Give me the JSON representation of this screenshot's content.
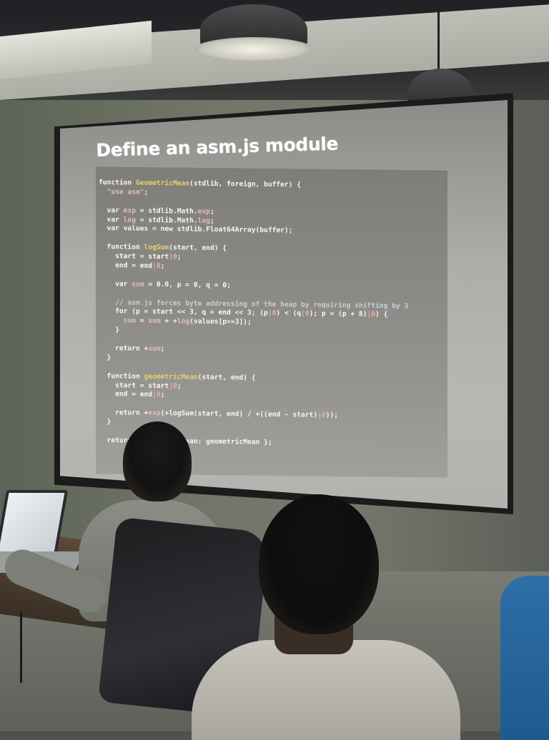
{
  "slide": {
    "title": "Define an asm.js module",
    "code": [
      {
        "parts": [
          [
            "kw",
            "function "
          ],
          [
            "fn",
            "GeometricMean"
          ],
          [
            "kw",
            "(stdlib, foreign, buffer) {"
          ]
        ]
      },
      {
        "parts": [
          [
            "str",
            "  \"use asm\""
          ],
          [
            "kw",
            ";"
          ]
        ]
      },
      {
        "parts": [
          [
            "kw",
            ""
          ]
        ]
      },
      {
        "parts": [
          [
            "kw",
            "  var "
          ],
          [
            "str",
            "exp"
          ],
          [
            "kw",
            " = stdlib.Math."
          ],
          [
            "str",
            "exp"
          ],
          [
            "kw",
            ";"
          ]
        ]
      },
      {
        "parts": [
          [
            "kw",
            "  var "
          ],
          [
            "str",
            "log"
          ],
          [
            "kw",
            " = stdlib.Math."
          ],
          [
            "str",
            "log"
          ],
          [
            "kw",
            ";"
          ]
        ]
      },
      {
        "parts": [
          [
            "kw",
            "  var values = new stdlib.Float64Array(buffer);"
          ]
        ]
      },
      {
        "parts": [
          [
            "kw",
            ""
          ]
        ]
      },
      {
        "parts": [
          [
            "kw",
            "  function "
          ],
          [
            "fn",
            "logSum"
          ],
          [
            "kw",
            "(start, end) {"
          ]
        ]
      },
      {
        "parts": [
          [
            "kw",
            "    start = start"
          ],
          [
            "bar",
            "|0"
          ],
          [
            "kw",
            ";"
          ]
        ]
      },
      {
        "parts": [
          [
            "kw",
            "    end = end"
          ],
          [
            "bar",
            "|0"
          ],
          [
            "kw",
            ";"
          ]
        ]
      },
      {
        "parts": [
          [
            "kw",
            ""
          ]
        ]
      },
      {
        "parts": [
          [
            "kw",
            "    var "
          ],
          [
            "str",
            "sum"
          ],
          [
            "kw",
            " = 0.0, p = 0, q = 0;"
          ]
        ]
      },
      {
        "parts": [
          [
            "kw",
            ""
          ]
        ]
      },
      {
        "parts": [
          [
            "cm",
            "    // asm.js forces byte addressing of the heap by requiring shifting by 3"
          ]
        ]
      },
      {
        "parts": [
          [
            "kw",
            "    for (p = start << 3, q = end << 3; (p"
          ],
          [
            "bar",
            "|0"
          ],
          [
            "kw",
            ") < (q"
          ],
          [
            "bar",
            "|0"
          ],
          [
            "kw",
            "); p = (p + 8)"
          ],
          [
            "bar",
            "|0"
          ],
          [
            "kw",
            ") {"
          ]
        ]
      },
      {
        "parts": [
          [
            "kw",
            "      "
          ],
          [
            "str",
            "sum"
          ],
          [
            "kw",
            " = "
          ],
          [
            "str",
            "sum"
          ],
          [
            "kw",
            " + +"
          ],
          [
            "str",
            "log"
          ],
          [
            "kw",
            "(values[p>>3]);"
          ]
        ]
      },
      {
        "parts": [
          [
            "kw",
            "    }"
          ]
        ]
      },
      {
        "parts": [
          [
            "kw",
            ""
          ]
        ]
      },
      {
        "parts": [
          [
            "kw",
            "    return +"
          ],
          [
            "str",
            "sum"
          ],
          [
            "kw",
            ";"
          ]
        ]
      },
      {
        "parts": [
          [
            "kw",
            "  }"
          ]
        ]
      },
      {
        "parts": [
          [
            "kw",
            ""
          ]
        ]
      },
      {
        "parts": [
          [
            "kw",
            "  function "
          ],
          [
            "fn",
            "geometricMean"
          ],
          [
            "kw",
            "(start, end) {"
          ]
        ]
      },
      {
        "parts": [
          [
            "kw",
            "    start = start"
          ],
          [
            "bar",
            "|0"
          ],
          [
            "kw",
            ";"
          ]
        ]
      },
      {
        "parts": [
          [
            "kw",
            "    end = end"
          ],
          [
            "bar",
            "|0"
          ],
          [
            "kw",
            ";"
          ]
        ]
      },
      {
        "parts": [
          [
            "kw",
            ""
          ]
        ]
      },
      {
        "parts": [
          [
            "kw",
            "    return +"
          ],
          [
            "str",
            "exp"
          ],
          [
            "kw",
            "(+logSum(start, end) / +((end - start)"
          ],
          [
            "bar",
            "|0"
          ],
          [
            "kw",
            "));"
          ]
        ]
      },
      {
        "parts": [
          [
            "kw",
            "  }"
          ]
        ]
      },
      {
        "parts": [
          [
            "kw",
            ""
          ]
        ]
      },
      {
        "parts": [
          [
            "kw",
            "  return { geometricMean: geometricMean };"
          ]
        ]
      }
    ]
  },
  "colors": {
    "slide_background": "#b3b2ae",
    "code_panel": "#8e8d89",
    "code_text": "#f8f8f0",
    "function_name": "#e6d26a",
    "string_literal": "#e4bdb0",
    "comment": "#c7cfd8"
  }
}
